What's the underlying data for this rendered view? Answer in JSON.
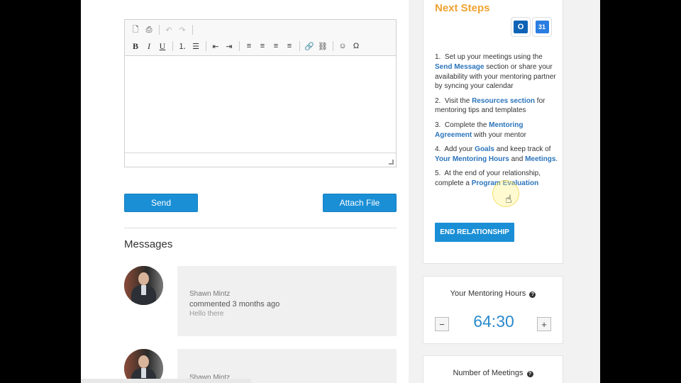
{
  "editor": {
    "toolbar_row1": [
      {
        "name": "preview-icon",
        "glyph": "🗋",
        "dim": false
      },
      {
        "name": "print-icon",
        "glyph": "⎙",
        "dim": false
      },
      {
        "name": "undo-icon",
        "glyph": "↶",
        "dim": true
      },
      {
        "name": "redo-icon",
        "glyph": "↷",
        "dim": true
      }
    ],
    "toolbar_row2": [
      {
        "name": "bold-icon",
        "glyph": "B"
      },
      {
        "name": "italic-icon",
        "glyph": "I"
      },
      {
        "name": "underline-icon",
        "glyph": "U"
      },
      {
        "name": "numbered-list-icon",
        "glyph": "⒈"
      },
      {
        "name": "bullet-list-icon",
        "glyph": "☰"
      },
      {
        "name": "outdent-icon",
        "glyph": "⇤"
      },
      {
        "name": "indent-icon",
        "glyph": "⇥"
      },
      {
        "name": "align-left-icon",
        "glyph": "≡"
      },
      {
        "name": "align-center-icon",
        "glyph": "≡"
      },
      {
        "name": "align-right-icon",
        "glyph": "≡"
      },
      {
        "name": "justify-icon",
        "glyph": "≡"
      },
      {
        "name": "link-icon",
        "glyph": "🔗"
      },
      {
        "name": "unlink-icon",
        "glyph": "⛓"
      },
      {
        "name": "emoji-icon",
        "glyph": "☺"
      },
      {
        "name": "special-char-icon",
        "glyph": "Ω"
      }
    ]
  },
  "actions": {
    "send_label": "Send",
    "attach_label": "Attach File"
  },
  "messages": {
    "title": "Messages",
    "items": [
      {
        "author": "Shawn Mintz",
        "when": "commented 3 months ago",
        "text": "Hello there"
      },
      {
        "author": "Shawn Mintz",
        "when": "",
        "text": ""
      }
    ]
  },
  "next_steps": {
    "title": "Next Steps",
    "outlook_label": "O",
    "gcal_label": "31",
    "step1": {
      "num": "1.",
      "pre": "Set up your meetings using the",
      "link": "Send Message",
      "post": "section or share your availability with your mentoring partner by syncing your calendar"
    },
    "step2": {
      "num": "2.",
      "pre": "Visit the",
      "link": "Resources section",
      "post": "for mentoring tips and templates"
    },
    "step3": {
      "num": "3.",
      "pre": "Complete the",
      "link": "Mentoring Agreement",
      "post": "with your mentor"
    },
    "step4": {
      "num": "4.",
      "pre": "Add your",
      "link": "Goals",
      "mid": "and keep track of",
      "link2": "Your Mentoring Hours",
      "mid2": "and",
      "link3": "Meetings",
      "post": "."
    },
    "step5": {
      "num": "5.",
      "pre": "At the end of your relationship, complete a",
      "link": "Program Evaluation",
      "post": ""
    },
    "end_button": "END RELATIONSHIP"
  },
  "hours": {
    "title": "Your Mentoring Hours",
    "help": "?",
    "value": "64:30",
    "minus": "−",
    "plus": "+"
  },
  "meetings": {
    "title": "Number of Meetings",
    "help": "?"
  },
  "colors": {
    "accent_blue": "#1a8fd6",
    "link_blue": "#2b74bb",
    "title_orange": "#f0a331"
  }
}
